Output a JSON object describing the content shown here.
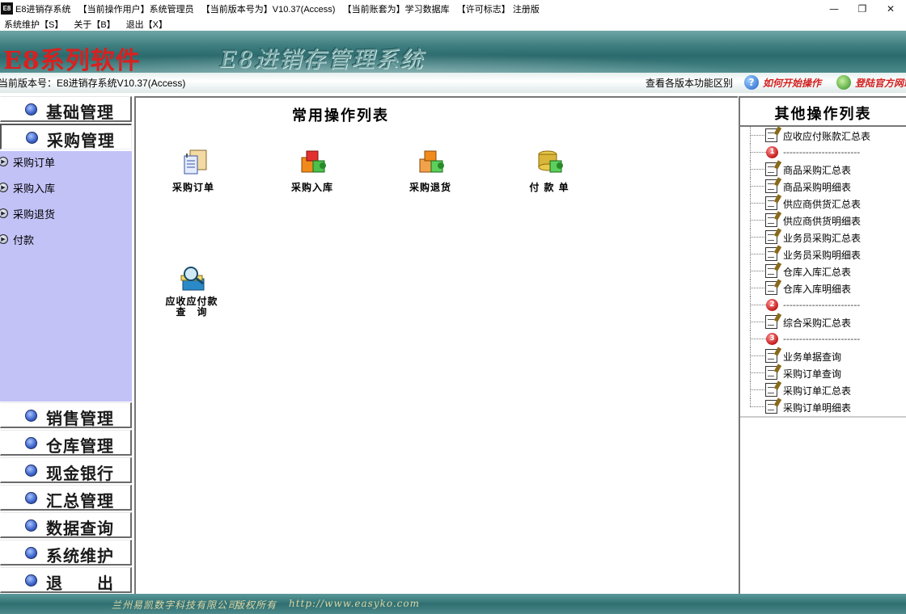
{
  "window": {
    "icon_text": "E8",
    "title": "E8进销存系统   【当前操作用户】系统管理员   【当前版本号为】V10.37(Access)   【当前账套为】学习数据库   【许可标志】 注册版",
    "controls": {
      "minimize": "—",
      "maximize": "❐",
      "close": "✕"
    }
  },
  "menubar": [
    {
      "label": "系统维护【S】"
    },
    {
      "label": "关于【B】"
    },
    {
      "label": "退出【X】"
    }
  ],
  "banner": {
    "brand": "E8系列软件",
    "system_name": "E8进销存管理系统"
  },
  "version_bar": {
    "version_text": "当前版本号：E8进销存系统V10.37(Access)",
    "features_link": "查看各版本功能区别",
    "help_icon": "question-icon",
    "howto_link": "如何开始操作",
    "site_icon": "globe-icon",
    "site_link": "登陆官方网站"
  },
  "left_nav": {
    "top_modules": [
      {
        "label": "基础管理"
      },
      {
        "label": "采购管理",
        "active": true
      }
    ],
    "sub_items": [
      {
        "label": "采购订单"
      },
      {
        "label": "采购入库"
      },
      {
        "label": "采购退货"
      },
      {
        "label": "付款"
      }
    ],
    "bottom_modules": [
      {
        "label": "销售管理"
      },
      {
        "label": "仓库管理"
      },
      {
        "label": "现金银行"
      },
      {
        "label": "汇总管理"
      },
      {
        "label": "数据查询"
      },
      {
        "label": "系统维护"
      },
      {
        "label": "退　　出"
      }
    ]
  },
  "center": {
    "heading": "常用操作列表",
    "tiles": [
      {
        "caption": "采购订单",
        "icon": "purchase-order-icon"
      },
      {
        "caption": "采购入库",
        "icon": "stock-in-icon"
      },
      {
        "caption": "采购退货",
        "icon": "purchase-return-icon"
      },
      {
        "caption": "付 款 单",
        "icon": "payment-icon"
      },
      {
        "caption": "应收应付款\n查　询",
        "icon": "ar-ap-query-icon"
      }
    ]
  },
  "right": {
    "heading": "其他操作列表",
    "groups": [
      {
        "items": [
          "应收应付账款汇总表"
        ]
      },
      {
        "number": "1",
        "separator": "------------------------",
        "items": [
          "商品采购汇总表",
          "商品采购明细表",
          "供应商供货汇总表",
          "供应商供货明细表",
          "业务员采购汇总表",
          "业务员采购明细表",
          "仓库入库汇总表",
          "仓库入库明细表"
        ]
      },
      {
        "number": "2",
        "separator": "------------------------",
        "items": [
          "综合采购汇总表"
        ]
      },
      {
        "number": "3",
        "separator": "------------------------",
        "items": [
          "业务单据查询",
          "采购订单查询",
          "采购订单汇总表",
          "采购订单明细表"
        ]
      }
    ]
  },
  "footer": {
    "company": "兰州易凯数字科技有限公司",
    "rights": "版权所有",
    "url": "http://www.easyko.com"
  },
  "colors": {
    "banner_teal": "#2b6a6d",
    "brand_red": "#d92020",
    "subpanel_lavender": "#c2c2f7",
    "nav_dot_blue": "#3b63c9"
  }
}
